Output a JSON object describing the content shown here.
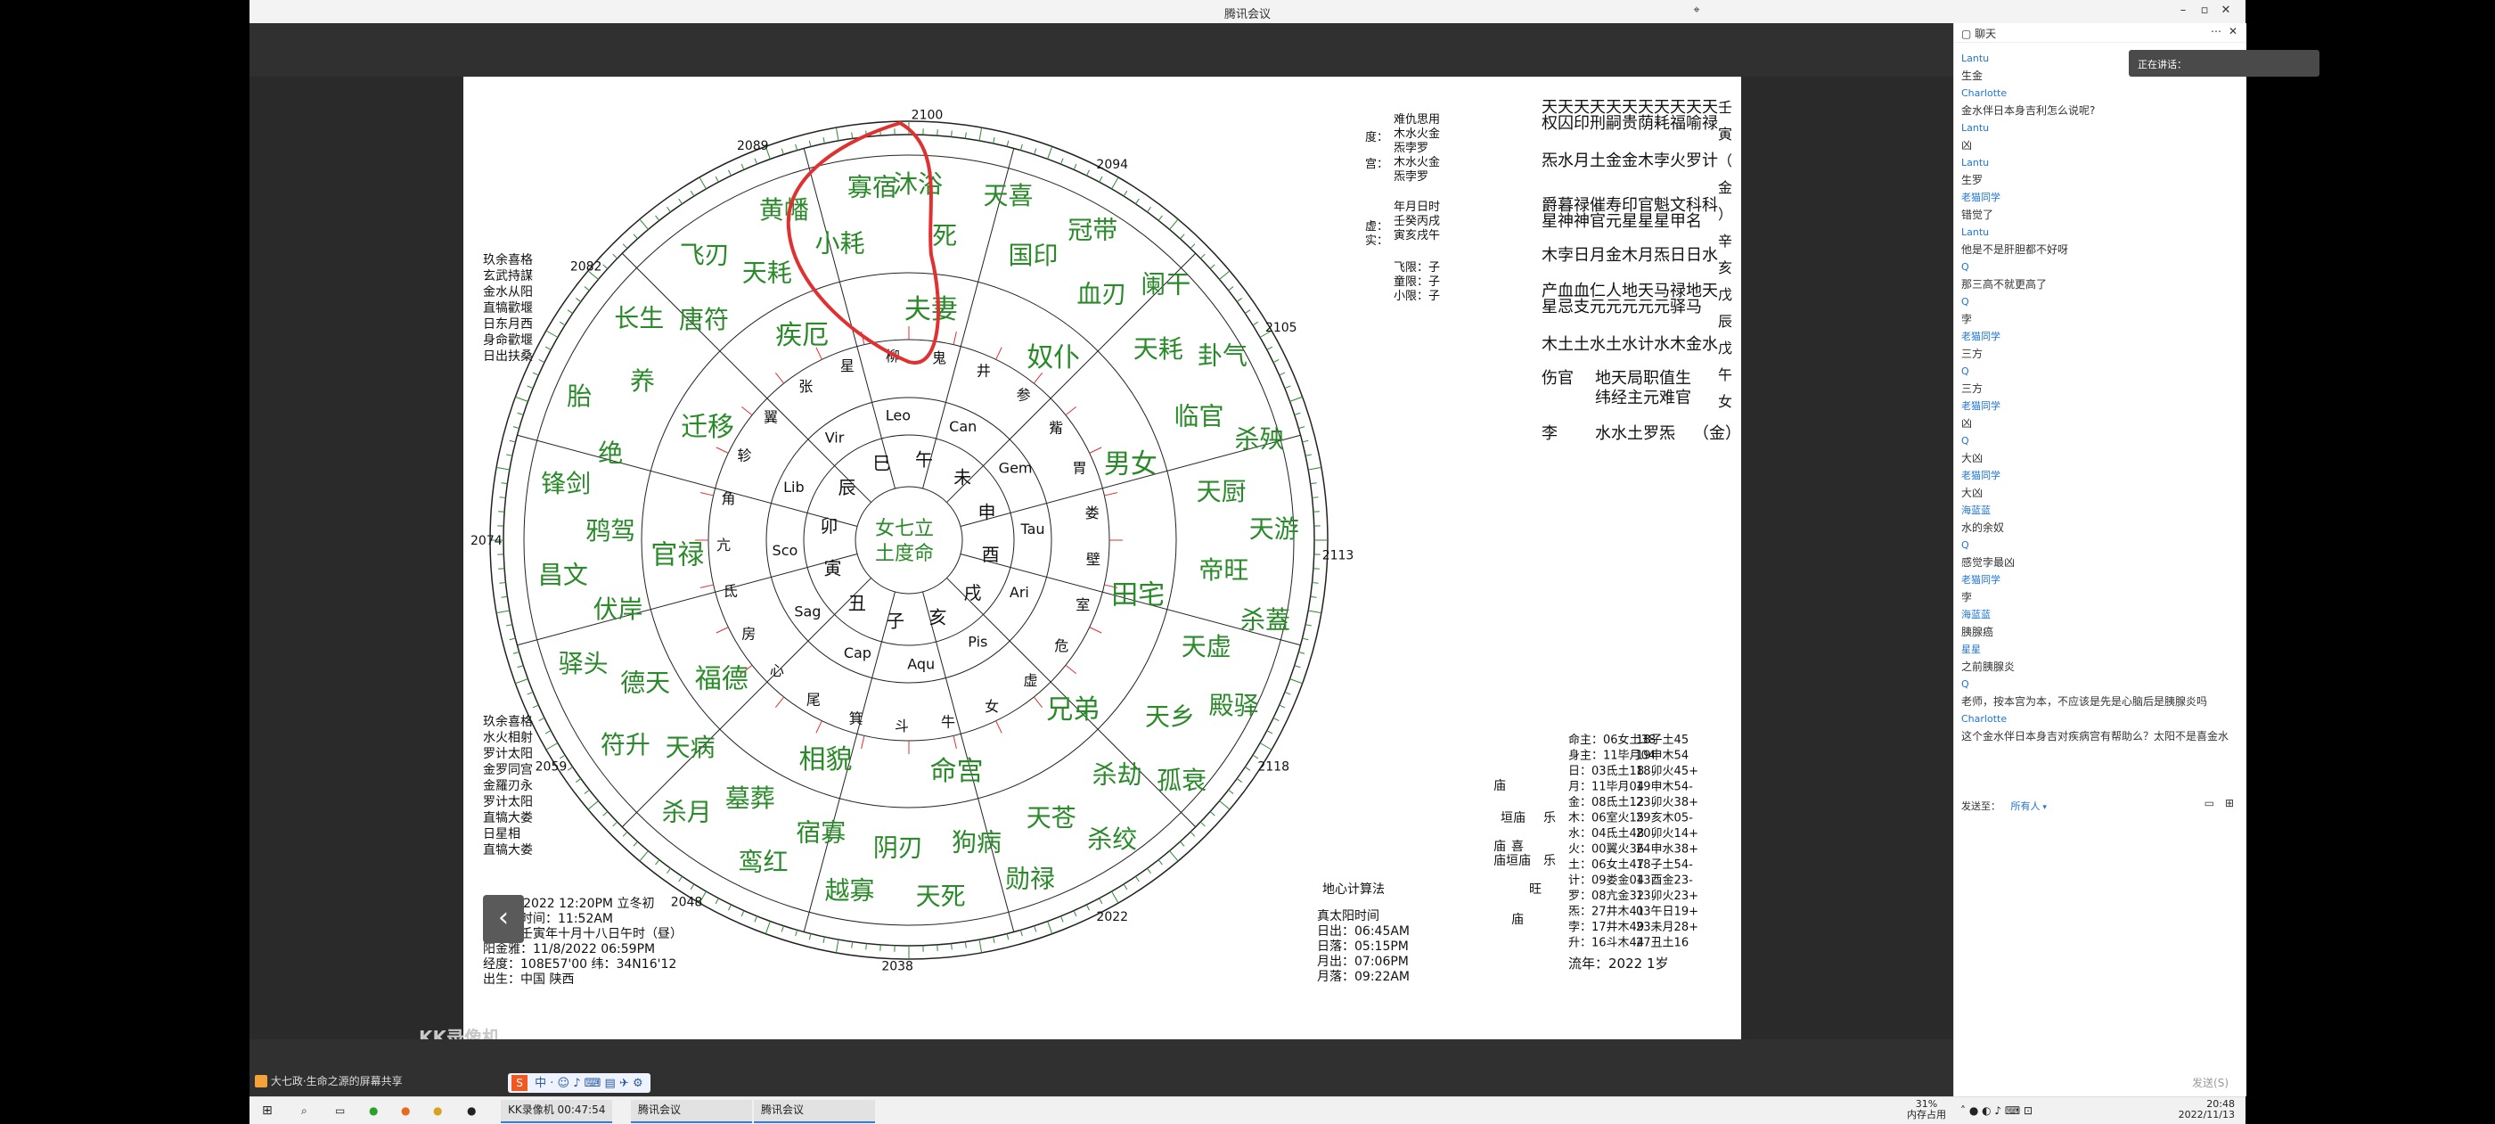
{
  "window": {
    "title": "腾讯会议"
  },
  "document": {
    "years": {
      "top": "2100",
      "tl": "2089",
      "tr": "2094",
      "left1": "2082",
      "left2": "2074",
      "left3": "2059",
      "right1": "2105",
      "right2": "2113",
      "right3": "2118",
      "bottom1": "2048",
      "bottom2": "2038",
      "bottom3": "2022"
    },
    "center": [
      "女七立",
      "土度命"
    ],
    "sectors": [
      "夫妻",
      "奴仆",
      "男女",
      "田宅",
      "兄弟",
      "命宫",
      "相貌",
      "福德",
      "官禄",
      "迁移",
      "疾厄"
    ],
    "zodiac": [
      "Leo",
      "Can",
      "Gem",
      "Tau",
      "Ari",
      "Pis",
      "Aqu",
      "Cap",
      "Sag",
      "Sco",
      "Lib",
      "Vir"
    ],
    "branches_ring": [
      "午",
      "未",
      "申",
      "酉",
      "戌",
      "亥",
      "子",
      "丑",
      "寅",
      "卯",
      "辰",
      "巳"
    ],
    "stars_ring": [
      "柳",
      "鬼",
      "井",
      "参",
      "觜",
      "胃",
      "娄",
      "壁",
      "室",
      "危",
      "虚",
      "女",
      "牛",
      "斗",
      "箕",
      "尾",
      "心",
      "房",
      "氐",
      "亢",
      "角",
      "轸",
      "翼",
      "张",
      "星"
    ],
    "outer_words": [
      "沐浴",
      "死",
      "天喜",
      "国印",
      "冠带",
      "血刃",
      "阑干",
      "天耗",
      "卦气",
      "临官",
      "杀殃",
      "天厨",
      "天游",
      "帝旺",
      "杀蓋",
      "天虚",
      "殿驿",
      "天乡",
      "孤衰",
      "杀劫",
      "杀绞",
      "天苍",
      "勋禄",
      "狗病",
      "天死",
      "阴刃",
      "越寡",
      "宿寡",
      "鸾红",
      "墓葬",
      "杀月",
      "天病",
      "符升",
      "德天",
      "驿头",
      "伏岸",
      "昌文",
      "鸦驾",
      "锋剑",
      "绝",
      "胎",
      "养",
      "长生",
      "唐符",
      "飞刃",
      "天耗",
      "黄幡",
      "小耗",
      "寡宿"
    ],
    "left_top_list": [
      "玖余喜格",
      "玄武持謀",
      "金水从阳",
      "直犒歡堰",
      "日东月西",
      "身命歡堰",
      "日出扶桑"
    ],
    "left_bottom_list": [
      "玖余喜格",
      "水火相射",
      "罗计太阳",
      "金罗同宫",
      "金羅刃永",
      "罗计太阳",
      "直犒大娄",
      "日星相",
      "直犒大娄"
    ],
    "top_right_header": [
      "度：",
      "宫：",
      "虚：",
      "实："
    ],
    "top_right_notes": [
      "难仇思用",
      "木水火金",
      "炁孛罗",
      "木水火金",
      "炁孛罗"
    ],
    "top_right_dates": [
      "年月日时",
      "壬癸丙戌",
      "寅亥戌午"
    ],
    "limits": [
      "飞限：子",
      "童限：子",
      "小限：子"
    ],
    "right_header": [
      "壬",
      "寅",
      "（",
      "金",
      "）",
      "辛",
      "亥",
      "戊",
      "辰",
      "戊",
      "午",
      "女"
    ],
    "right_star_row1": "天天天天天天天天天天天",
    "right_star_row2": "权囚印刑嗣贵荫耗福喻禄",
    "right_star_row3": "炁水月土金金木孛火罗计",
    "right_star_row4": "爵暮禄催寿印官魁文科科",
    "right_star_row5": "星神神官元星星星甲名",
    "right_star_row6": "木孛日月金木月炁日日水",
    "right_star_row7": "产血血仁人地天马禄地天",
    "right_star_row8": "星忌支元元元元元驿马",
    "right_star_row9": "木土土水土水计水木金水",
    "right_list_a": [
      "伤官",
      "地天局职值生"
    ],
    "right_list_b": [
      "纬经主元难官"
    ],
    "right_list_c": [
      "李",
      "水水土罗炁",
      "（金）"
    ],
    "bottom_left_info": [
      "11/11/2022 12:20PM 立冬初",
      "真太阳时间：11:52AM",
      "阴历：壬寅年十月十八日午时（昼）",
      "阳金雅：11/8/2022 06:59PM",
      "经度：108E57'00  纬：34N16'12",
      "出生：中国 陕西"
    ],
    "bottom_center_info": {
      "title": "地心计算法",
      "rows": [
        "真太阳时间",
        "日出：06:45AM",
        "日落：05:15PM",
        "月出：07:06PM",
        "月落：09:22AM"
      ]
    },
    "bottom_right_rows": [
      [
        "命主：06女土38",
        "18子土45"
      ],
      [
        "身主：11毕月04",
        "19申木54"
      ],
      [
        "日：03氐土18",
        "18卯火45+"
      ],
      [
        "月：11毕月04",
        "19申木54-"
      ],
      [
        "金：08氐土12",
        "23卯火38+"
      ],
      [
        "木：06室火15",
        "29亥木05-"
      ],
      [
        "水：04氐土48",
        "20卯火14+"
      ],
      [
        "火：00翼火36",
        "24申水38+"
      ],
      [
        "土：06女土47",
        "18子土54-"
      ],
      [
        "计：09娄金04",
        "13酉金23-"
      ],
      [
        "罗：08亢金32",
        "13卯火23+"
      ],
      [
        "炁：27井木41",
        "03午日19+"
      ],
      [
        "孛：17井木49",
        "23未月28+"
      ],
      [
        "升：16斗木44",
        "27丑土16"
      ]
    ],
    "bottom_right_labels": [
      "庙",
      "垣庙",
      "乐",
      "庙",
      "喜",
      "庙垣庙",
      "乐",
      "旺",
      "庙"
    ],
    "liu_nian": "流年：2022   1岁"
  },
  "share": {
    "text": "大七政·生命之源的屏幕共享"
  },
  "watermark": "KK录像机",
  "chat": {
    "title": "聊天",
    "speaking": "正在讲话：",
    "messages": [
      {
        "who": "Lantu",
        "text": "生金"
      },
      {
        "who": "Charlotte",
        "text": "金水伴日本身吉利怎么说呢?"
      },
      {
        "who": "Lantu",
        "text": "凶"
      },
      {
        "who": "Lantu",
        "text": "生罗"
      },
      {
        "who": "老猫同学",
        "text": "错觉了"
      },
      {
        "who": "Lantu",
        "text": "他是不是肝胆都不好呀"
      },
      {
        "who": "Q",
        "text": "那三高不就更高了"
      },
      {
        "who": "Q",
        "text": "孛"
      },
      {
        "who": "老猫同学",
        "text": "三方"
      },
      {
        "who": "Q",
        "text": "三方"
      },
      {
        "who": "老猫同学",
        "text": "凶"
      },
      {
        "who": "Q",
        "text": "大凶"
      },
      {
        "who": "老猫同学",
        "text": "大凶"
      },
      {
        "who": "海蓝蓝",
        "text": "水的余奴"
      },
      {
        "who": "Q",
        "text": "感觉孛最凶"
      },
      {
        "who": "老猫同学",
        "text": "孛"
      },
      {
        "who": "海蓝蓝",
        "text": "胰腺癌"
      },
      {
        "who": "星星",
        "text": "之前胰腺炎"
      },
      {
        "who": "Q",
        "text": "老师，按本宫为本，不应该是先是心脑后是胰腺炎吗"
      },
      {
        "who": "Charlotte",
        "text": "这个金水伴日本身吉对疾病宫有帮助么？太阳不是喜金水"
      }
    ],
    "send_to_label": "发送至：",
    "send_to_value": "所有人",
    "send_button": "发送(S)"
  },
  "taskbar": {
    "kk": "KK录像机 00:47:54",
    "app1": "腾讯会议",
    "app2": "腾讯会议",
    "mem_pct": "31%",
    "mem_label": "内存占用",
    "time": "20:48",
    "date": "2022/11/13"
  },
  "colors": {
    "green": "#2a8a2a",
    "red": "#e03030",
    "blue": "#1e74d9",
    "black": "#111111"
  }
}
